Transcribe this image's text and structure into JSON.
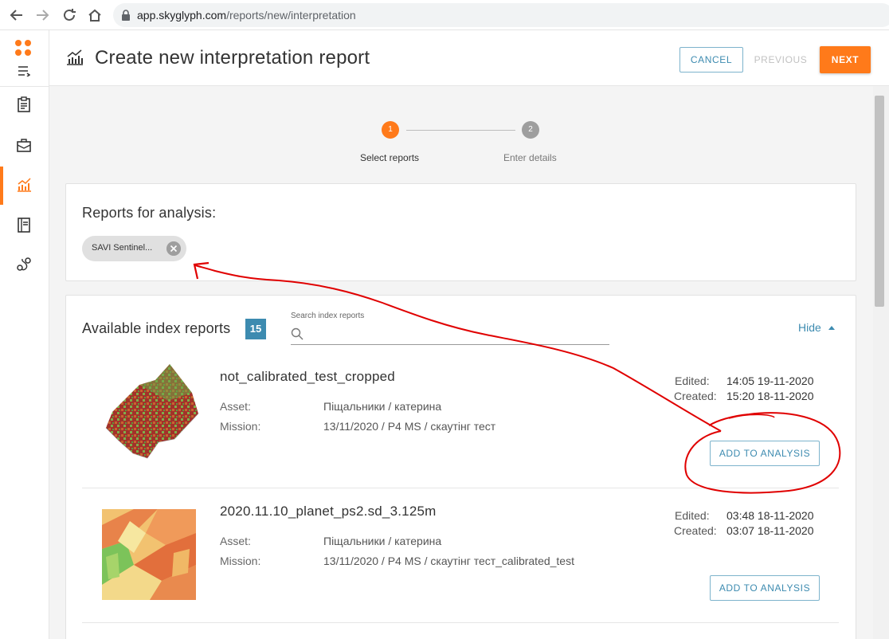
{
  "browser": {
    "url_host": "app.skyglyph.com",
    "url_path": "/reports/new/interpretation"
  },
  "header": {
    "title": "Create new interpretation report",
    "cancel_label": "CANCEL",
    "previous_label": "PREVIOUS",
    "next_label": "NEXT"
  },
  "stepper": {
    "steps": [
      {
        "number": "1",
        "label": "Select reports",
        "active": true
      },
      {
        "number": "2",
        "label": "Enter details",
        "active": false
      }
    ]
  },
  "analysis": {
    "title": "Reports for analysis:",
    "chips": [
      {
        "label": "SAVI Sentinel..."
      }
    ]
  },
  "available": {
    "title": "Available index reports",
    "count": "15",
    "search_label": "Search index reports",
    "search_placeholder": "",
    "hide_label": "Hide",
    "labels": {
      "asset": "Asset:",
      "mission": "Mission:",
      "edited": "Edited:",
      "created": "Created:",
      "add_button": "ADD TO ANALYSIS"
    },
    "reports": [
      {
        "name": "not_calibrated_test_cropped",
        "asset": "Піщальники / катерина",
        "mission": "13/11/2020 / P4 MS / скаутінг тест",
        "edited": "14:05 19-11-2020",
        "created": "15:20 18-11-2020"
      },
      {
        "name": "2020.11.10_planet_ps2.sd_3.125m",
        "asset": "Піщальники / катерина",
        "mission": "13/11/2020 / P4 MS / скаутінг тест_calibrated_test",
        "edited": "03:48 18-11-2020",
        "created": "03:07 18-11-2020"
      }
    ]
  },
  "colors": {
    "accent": "#ff7a1a",
    "link": "#3d8bb0",
    "annotation": "#e00000"
  },
  "icons": {
    "sidebar": [
      "clipboard-icon",
      "briefcase-icon",
      "chart-icon",
      "notebook-icon",
      "route-icon"
    ]
  }
}
